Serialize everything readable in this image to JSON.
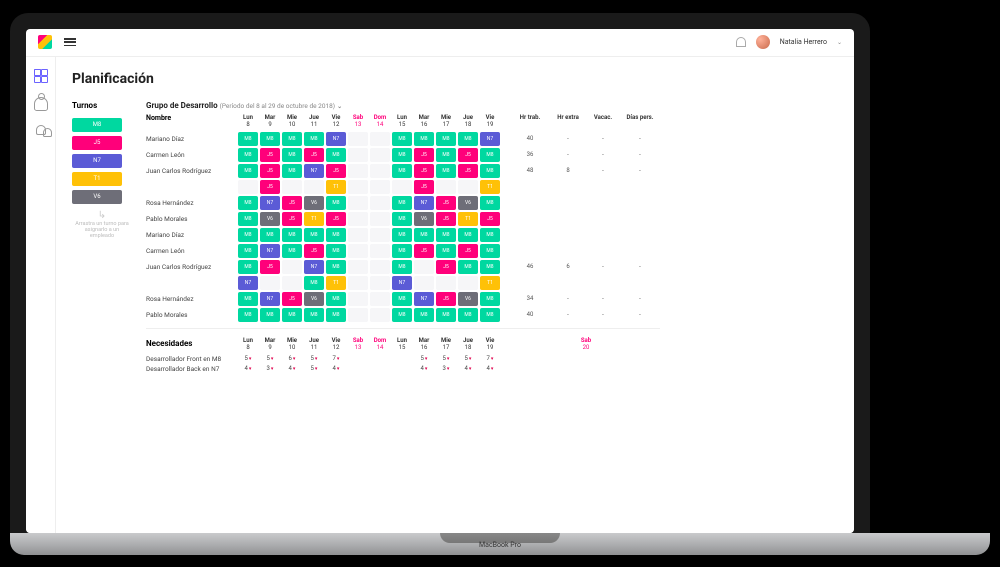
{
  "user": {
    "name": "Natalia Herrero"
  },
  "page_title": "Planificación",
  "turnos": {
    "title": "Turnos",
    "items": [
      {
        "code": "M8",
        "color": "#00d8a0"
      },
      {
        "code": "J5",
        "color": "#ff007a"
      },
      {
        "code": "N7",
        "color": "#5b5bd6"
      },
      {
        "code": "T1",
        "color": "#ffc107"
      },
      {
        "code": "V6",
        "color": "#6e6e78"
      }
    ],
    "hint": "Arrastra un turno para asignarlo a un empleado"
  },
  "group": {
    "name": "Grupo de Desarrollo",
    "period": "(Período del 8 al 29 de octubre de 2018)"
  },
  "columns": {
    "name": "Nombre",
    "days": [
      {
        "label": "Lun",
        "num": "8",
        "weekend": false
      },
      {
        "label": "Mar",
        "num": "9",
        "weekend": false
      },
      {
        "label": "Mie",
        "num": "10",
        "weekend": false
      },
      {
        "label": "Jue",
        "num": "11",
        "weekend": false
      },
      {
        "label": "Vie",
        "num": "12",
        "weekend": false
      },
      {
        "label": "Sab",
        "num": "13",
        "weekend": true
      },
      {
        "label": "Dom",
        "num": "14",
        "weekend": true
      },
      {
        "label": "Lun",
        "num": "15",
        "weekend": false
      },
      {
        "label": "Mar",
        "num": "16",
        "weekend": false
      },
      {
        "label": "Mie",
        "num": "17",
        "weekend": false
      },
      {
        "label": "Jue",
        "num": "18",
        "weekend": false
      },
      {
        "label": "Vie",
        "num": "19",
        "weekend": false
      }
    ],
    "extra_day": {
      "label": "Sab",
      "num": "20",
      "weekend": true
    },
    "stats": [
      "Hr trab.",
      "Hr extra",
      "Vacac.",
      "Días pers."
    ]
  },
  "rows": [
    {
      "name": "Mariano Díaz",
      "shifts": [
        "M8",
        "M8",
        "M8",
        "M8",
        "N7",
        "",
        "",
        "M8",
        "M8",
        "M8",
        "M8",
        "N7"
      ],
      "stats": [
        "40",
        "-",
        "-",
        "-"
      ]
    },
    {
      "name": "Carmen León",
      "shifts": [
        "M8",
        "J5",
        "M8",
        "J5",
        "M8",
        "",
        "",
        "M8",
        "J5",
        "M8",
        "J5",
        "M8"
      ],
      "stats": [
        "36",
        "-",
        "-",
        "-"
      ]
    },
    {
      "name": "Juan Carlos Rodríguez",
      "shifts": [
        "M8",
        "J5",
        "M8",
        "N7",
        "J5",
        "",
        "",
        "M8",
        "J5",
        "M8",
        "J5",
        "M8"
      ],
      "stats": [
        "48",
        "8",
        "-",
        "-"
      ]
    },
    {
      "spacer": true,
      "shifts": [
        "",
        "J5",
        "",
        "",
        "T1",
        "",
        "",
        "",
        "J5",
        "",
        "",
        "T1"
      ],
      "stats": [
        "",
        "",
        "",
        ""
      ]
    },
    {
      "name": "Rosa Hernández",
      "shifts": [
        "M8",
        "N7",
        "J5",
        "V6",
        "M8",
        "",
        "",
        "M8",
        "N7",
        "J5",
        "V6",
        "M8"
      ],
      "stats": [
        "",
        "",
        "",
        ""
      ]
    },
    {
      "name": "Pablo Morales",
      "shifts": [
        "M8",
        "V6",
        "J5",
        "T1",
        "J5",
        "",
        "",
        "M8",
        "V6",
        "J5",
        "T1",
        "J5"
      ],
      "stats": [
        "",
        "",
        "",
        ""
      ]
    },
    {
      "name": "Mariano Díaz",
      "shifts": [
        "M8",
        "M8",
        "M8",
        "M8",
        "M8",
        "",
        "",
        "M8",
        "M8",
        "M8",
        "M8",
        "M8"
      ],
      "stats": [
        "",
        "",
        "",
        ""
      ]
    },
    {
      "name": "Carmen León",
      "shifts": [
        "M8",
        "N7",
        "M8",
        "J5",
        "M8",
        "",
        "",
        "M8",
        "J5",
        "M8",
        "J5",
        "M8"
      ],
      "stats": [
        "",
        "",
        "",
        ""
      ]
    },
    {
      "name": "Juan Carlos Rodríguez",
      "shifts": [
        "M8",
        "J5",
        "",
        "N7",
        "M8",
        "",
        "",
        "M8",
        "",
        "J5",
        "M8",
        "M8"
      ],
      "stats": [
        "46",
        "6",
        "-",
        "-"
      ]
    },
    {
      "spacer": true,
      "shifts": [
        "N7",
        "",
        "",
        "M8",
        "T1",
        "",
        "",
        "N7",
        "",
        "",
        "",
        "T1"
      ],
      "stats": [
        "",
        "",
        "",
        ""
      ]
    },
    {
      "name": "Rosa Hernández",
      "shifts": [
        "M8",
        "N7",
        "J5",
        "V6",
        "M8",
        "",
        "",
        "M8",
        "N7",
        "J5",
        "V6",
        "M8"
      ],
      "stats": [
        "34",
        "-",
        "-",
        "-"
      ]
    },
    {
      "name": "Pablo Morales",
      "shifts": [
        "M8",
        "M8",
        "M8",
        "M8",
        "M8",
        "",
        "",
        "M8",
        "M8",
        "M8",
        "M8",
        "M8"
      ],
      "stats": [
        "40",
        "-",
        "-",
        "-"
      ]
    }
  ],
  "needs": {
    "title": "Necesidades",
    "rows": [
      {
        "name": "Desarrollador Front en M8",
        "vals": [
          "5",
          "5",
          "6",
          "5",
          "7",
          "",
          "",
          "",
          "5",
          "5",
          "5",
          "7"
        ]
      },
      {
        "name": "Desarrollador Back en N7",
        "vals": [
          "4",
          "3",
          "4",
          "5",
          "4",
          "",
          "",
          "",
          "4",
          "3",
          "4",
          "4"
        ]
      }
    ]
  },
  "colors": {
    "M8": "#00d8a0",
    "J5": "#ff007a",
    "N7": "#5b5bd6",
    "T1": "#ffc107",
    "V6": "#6e6e78"
  }
}
